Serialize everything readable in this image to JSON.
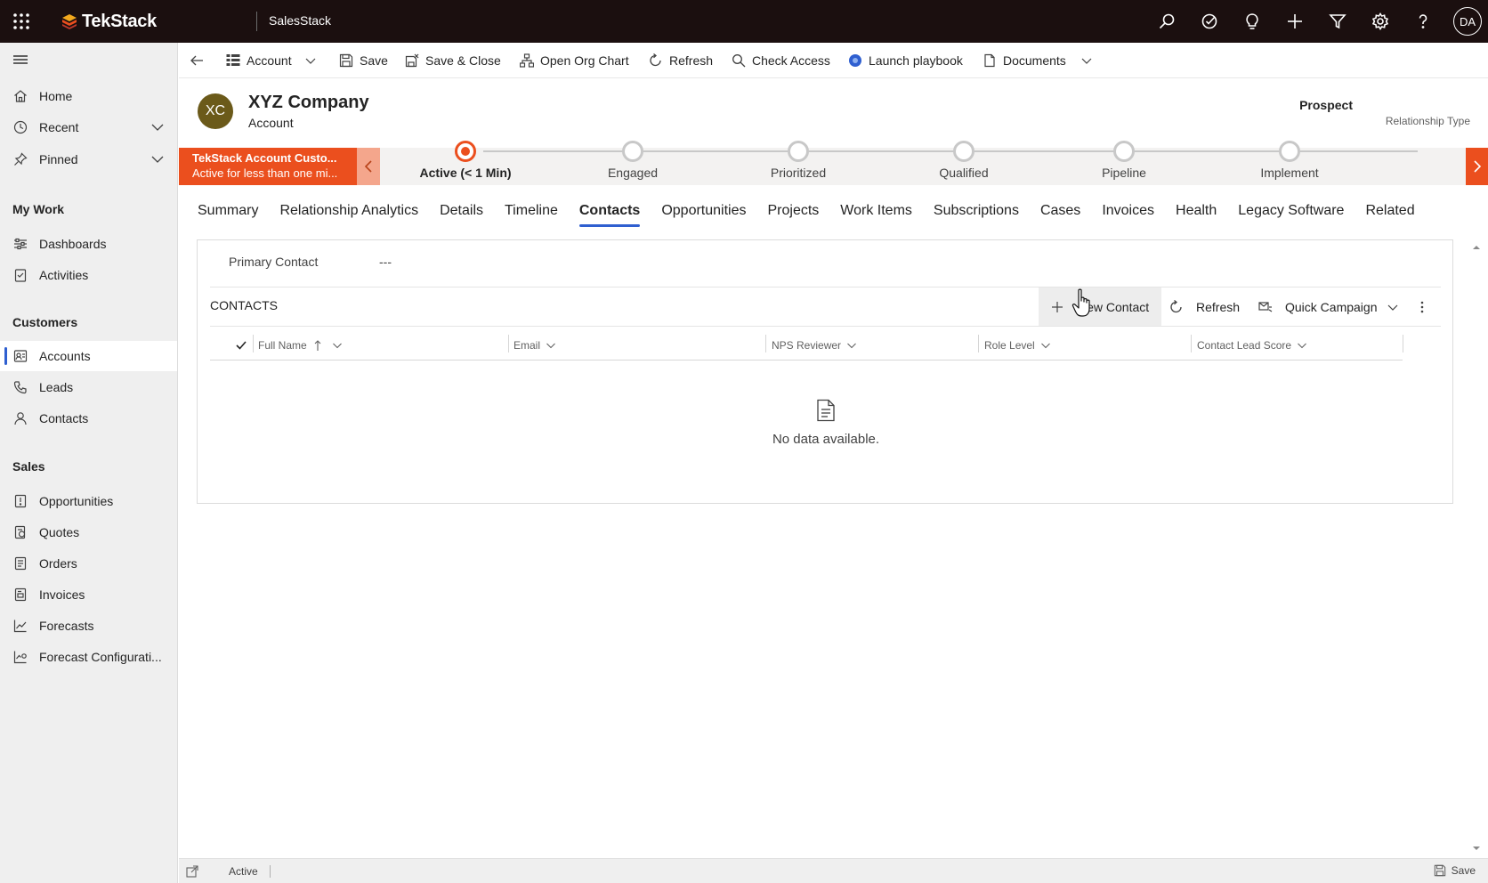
{
  "topbar": {
    "brand": "TekStack",
    "app_name": "SalesStack",
    "user_initials": "DA",
    "icons": [
      "search-icon",
      "task-icon",
      "lightbulb-icon",
      "plus-icon",
      "filter-icon",
      "gear-icon",
      "help-icon"
    ]
  },
  "sidebar": {
    "home": "Home",
    "recent": "Recent",
    "pinned": "Pinned",
    "my_work": {
      "heading": "My Work",
      "items": [
        "Dashboards",
        "Activities"
      ]
    },
    "customers": {
      "heading": "Customers",
      "items": [
        "Accounts",
        "Leads",
        "Contacts"
      ],
      "selected": "Accounts"
    },
    "sales": {
      "heading": "Sales",
      "items": [
        "Opportunities",
        "Quotes",
        "Orders",
        "Invoices",
        "Forecasts",
        "Forecast Configurati..."
      ]
    }
  },
  "commandbar": {
    "account": "Account",
    "save": "Save",
    "save_close": "Save & Close",
    "org_chart": "Open Org Chart",
    "refresh": "Refresh",
    "check_access": "Check Access",
    "launch_playbook": "Launch playbook",
    "documents": "Documents"
  },
  "record": {
    "initials": "XC",
    "title": "XYZ Company",
    "entity": "Account",
    "relationship_value": "Prospect",
    "relationship_label": "Relationship Type"
  },
  "bpf": {
    "process_name": "TekStack Account Custo...",
    "process_status": "Active for less than one mi...",
    "stages": [
      "Active  (< 1 Min)",
      "Engaged",
      "Prioritized",
      "Qualified",
      "Pipeline",
      "Implement"
    ],
    "active_stage": 0
  },
  "tabs": [
    "Summary",
    "Relationship Analytics",
    "Details",
    "Timeline",
    "Contacts",
    "Opportunities",
    "Projects",
    "Work Items",
    "Subscriptions",
    "Cases",
    "Invoices",
    "Health",
    "Legacy Software",
    "Related"
  ],
  "selected_tab": "Contacts",
  "contacts_section": {
    "primary_contact_label": "Primary Contact",
    "primary_contact_value": "---",
    "subgrid_title": "CONTACTS",
    "new_contact": "New Contact",
    "refresh": "Refresh",
    "quick_campaign": "Quick Campaign",
    "columns": [
      "Full Name",
      "Email",
      "NPS Reviewer",
      "Role Level",
      "Contact Lead Score"
    ],
    "sort_column": "Full Name",
    "sort_direction": "ascending",
    "empty_message": "No data available."
  },
  "statusbar": {
    "status": "Active",
    "save": "Save"
  },
  "colors": {
    "topbar": "#1b0f0f",
    "accent_orange": "#eb4f1e",
    "selection_blue": "#2f5fd0",
    "avatar_bg": "#6b5a1a"
  }
}
